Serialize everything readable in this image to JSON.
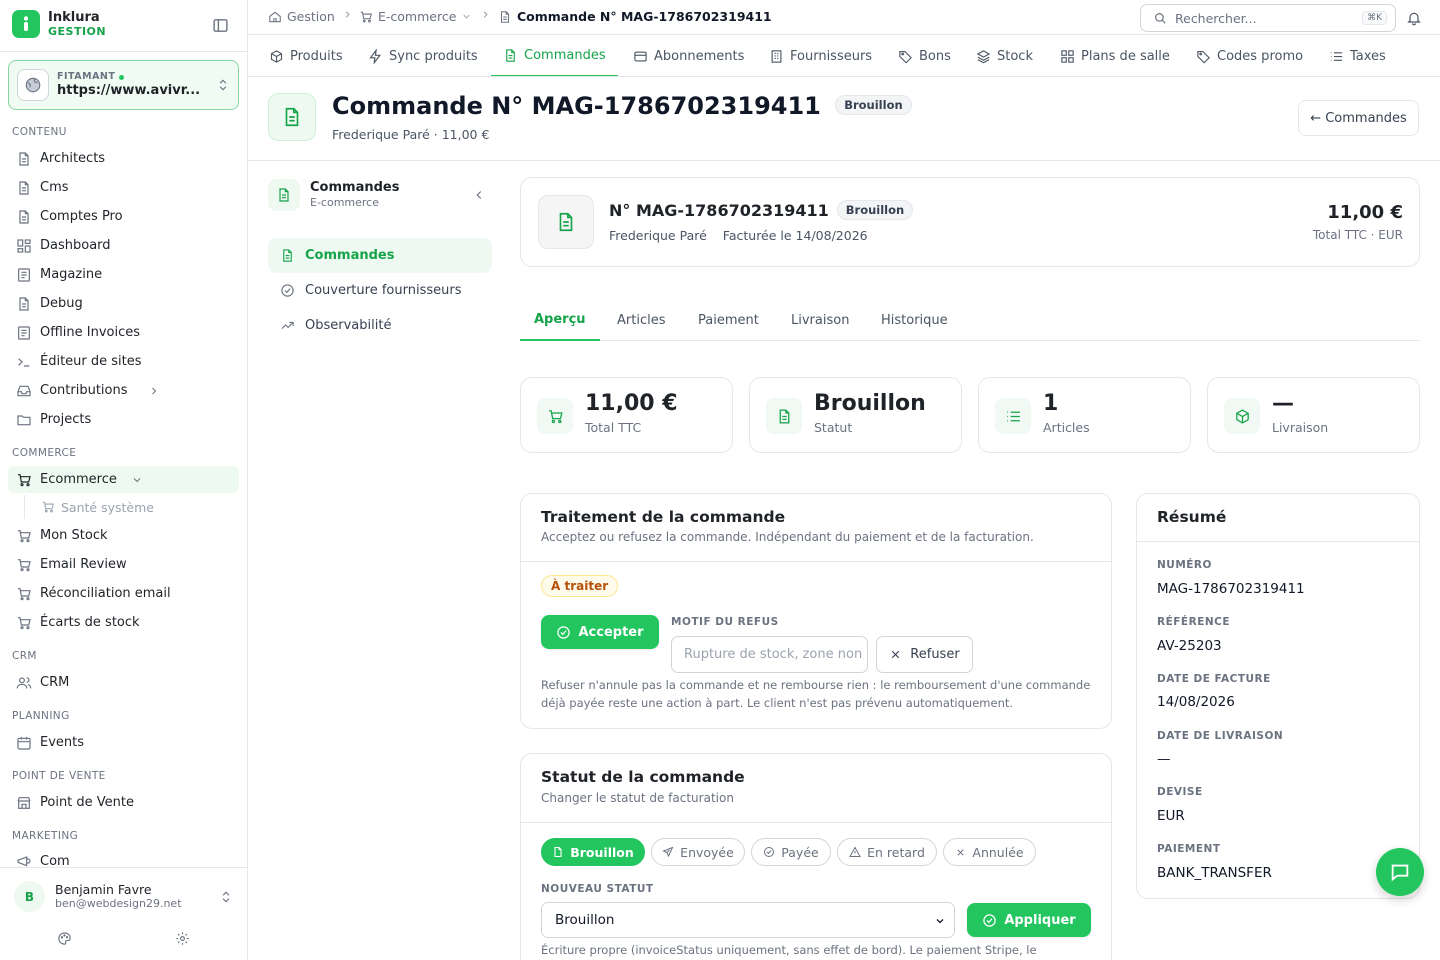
{
  "brand": {
    "name": "Inklura",
    "sub": "GESTION"
  },
  "tenant": {
    "label": "FITAMANT",
    "url": "https://www.avivr..."
  },
  "sidebar": {
    "sections": {
      "contenu": "CONTENU",
      "commerce": "COMMERCE",
      "crm": "CRM",
      "planning": "PLANNING",
      "pdv": "POINT DE VENTE",
      "marketing": "MARKETING"
    },
    "contenu": [
      "Architects",
      "Cms",
      "Comptes Pro",
      "Dashboard",
      "Magazine",
      "Debug",
      "Offline Invoices",
      "Éditeur de sites",
      "Contributions",
      "Projects"
    ],
    "ecommerce": "Ecommerce",
    "sante": "Santé système",
    "commerce": [
      "Mon Stock",
      "Email Review",
      "Réconciliation email",
      "Écarts de stock"
    ],
    "crm": "CRM",
    "events": "Events",
    "pdv": "Point de Vente",
    "com": "Com"
  },
  "user": {
    "initial": "B",
    "name": "Benjamin Favre",
    "email": "ben@webdesign29.net"
  },
  "breadcrumb": {
    "home": "Gestion",
    "section": "E-commerce",
    "current": "Commande N° MAG-1786702319411"
  },
  "search": {
    "placeholder": "Rechercher...",
    "shortcut": "⌘K"
  },
  "modules": [
    "Produits",
    "Sync produits",
    "Commandes",
    "Abonnements",
    "Fournisseurs",
    "Bons",
    "Stock",
    "Plans de salle",
    "Codes promo",
    "Taxes"
  ],
  "page": {
    "title": "Commande N° MAG-1786702319411",
    "status": "Brouillon",
    "subtitle": "Frederique Paré · 11,00 €",
    "back": "← Commandes"
  },
  "subnav": {
    "title": "Commandes",
    "sub": "E-commerce",
    "items": [
      "Commandes",
      "Couverture fournisseurs",
      "Observabilité"
    ]
  },
  "order": {
    "number": "N° MAG-1786702319411",
    "status": "Brouillon",
    "customer": "Frederique Paré",
    "invoiced": "Facturée le 14/08/2026",
    "total": "11,00 €",
    "total_label": "Total TTC · EUR"
  },
  "tabs": [
    "Aperçu",
    "Articles",
    "Paiement",
    "Livraison",
    "Historique"
  ],
  "stats": [
    {
      "value": "11,00 €",
      "label": "Total TTC",
      "icon": "cart-icon"
    },
    {
      "value": "Brouillon",
      "label": "Statut",
      "icon": "document-icon"
    },
    {
      "value": "1",
      "label": "Articles",
      "icon": "list-icon"
    },
    {
      "value": "—",
      "label": "Livraison",
      "icon": "package-icon"
    }
  ],
  "treatment": {
    "title": "Traitement de la commande",
    "subtitle": "Acceptez ou refusez la commande. Indépendant du paiement et de la facturation.",
    "badge": "À traiter",
    "accept": "Accepter",
    "reason_label": "MOTIF DU REFUS",
    "reason_placeholder": "Rupture de stock, zone non desservie",
    "refuse": "Refuser",
    "note": "Refuser n'annule pas la commande et ne rembourse rien : le remboursement d'une commande déjà payée reste une action à part. Le client n'est pas prévenu automatiquement."
  },
  "status_card": {
    "title": "Statut de la commande",
    "subtitle": "Changer le statut de facturation",
    "chips": [
      "Brouillon",
      "Envoyée",
      "Payée",
      "En retard",
      "Annulée"
    ],
    "new_label": "NOUVEAU STATUT",
    "selected": "Brouillon",
    "apply": "Appliquer",
    "note": "Écriture propre (invoiceStatus uniquement, sans effet de bord). Le paiement Stripe, le"
  },
  "summary": {
    "title": "Résumé",
    "rows": [
      {
        "label": "NUMÉRO",
        "value": "MAG-1786702319411"
      },
      {
        "label": "RÉFÉRENCE",
        "value": "AV-25203"
      },
      {
        "label": "DATE DE FACTURE",
        "value": "14/08/2026"
      },
      {
        "label": "DATE DE LIVRAISON",
        "value": "—"
      },
      {
        "label": "DEVISE",
        "value": "EUR"
      },
      {
        "label": "PAIEMENT",
        "value": "BANK_TRANSFER"
      }
    ]
  },
  "colors": {
    "accent": "#22c55e",
    "accent_dark": "#16a34a",
    "warning": "#b45309"
  }
}
